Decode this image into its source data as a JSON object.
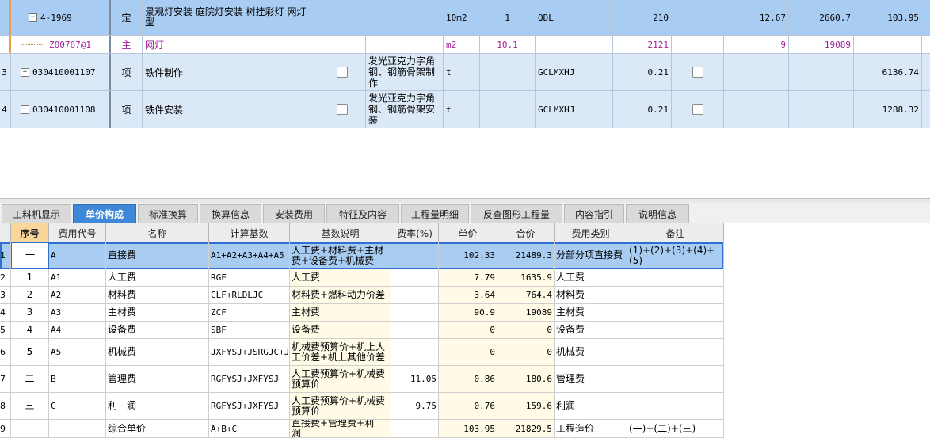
{
  "top_rows": [
    {
      "rownum": "",
      "code": "4-1969",
      "type": "定",
      "name": "景观灯安装 庭院灯安装 树挂彩灯 网灯型",
      "feature": "",
      "unit": "10m2",
      "qty": "1",
      "qty_expr": "QDL",
      "c1": "210",
      "c2": "",
      "c3": "12.67",
      "c4": "2660.7",
      "c5": "103.95"
    },
    {
      "rownum": "",
      "code": "Z00767@1",
      "type": "主",
      "name": "网灯",
      "feature": "",
      "unit": "m2",
      "qty": "10.1",
      "qty_expr": "",
      "c1": "2121",
      "c2": "",
      "c3": "9",
      "c4": "19089",
      "c5": ""
    },
    {
      "rownum": "3",
      "code": "030410001107",
      "type": "项",
      "name": "铁件制作",
      "feature": "发光亚克力字角钢、钢筋骨架制作",
      "unit": "t",
      "qty": "",
      "qty_expr": "GCLMXHJ",
      "c1": "0.21",
      "c2": "",
      "c3": "",
      "c4": "",
      "c5": "6136.74"
    },
    {
      "rownum": "4",
      "code": "030410001108",
      "type": "项",
      "name": "铁件安装",
      "feature": "发光亚克力字角钢、钢筋骨架安装",
      "unit": "t",
      "qty": "",
      "qty_expr": "GCLMXHJ",
      "c1": "0.21",
      "c2": "",
      "c3": "",
      "c4": "",
      "c5": "1288.32"
    }
  ],
  "tabs": [
    "工料机显示",
    "单价构成",
    "标准换算",
    "换算信息",
    "安装费用",
    "特征及内容",
    "工程量明细",
    "反查图形工程量",
    "内容指引",
    "说明信息"
  ],
  "active_tab": "单价构成",
  "headers": [
    "序号",
    "费用代号",
    "名称",
    "计算基数",
    "基数说明",
    "费率(%)",
    "单价",
    "合价",
    "费用类别",
    "备注"
  ],
  "rows": [
    {
      "n": "1",
      "seq": "一",
      "code": "A",
      "name": "直接费",
      "base": "A1+A2+A3+A4+A5",
      "desc": "人工费+材料费+主材费+设备费+机械费",
      "rate": "",
      "price": "102.33",
      "total": "21489.3",
      "cat": "分部分项直接费",
      "note": "(1)+(2)+(3)+(4)+(5)"
    },
    {
      "n": "2",
      "seq": "1",
      "code": "A1",
      "name": "人工费",
      "base": "RGF",
      "desc": "人工费",
      "rate": "",
      "price": "7.79",
      "total": "1635.9",
      "cat": "人工费",
      "note": ""
    },
    {
      "n": "3",
      "seq": "2",
      "code": "A2",
      "name": "材料费",
      "base": "CLF+RLDLJC",
      "desc": "材料费+燃料动力价差",
      "rate": "",
      "price": "3.64",
      "total": "764.4",
      "cat": "材料费",
      "note": ""
    },
    {
      "n": "4",
      "seq": "3",
      "code": "A3",
      "name": "主材费",
      "base": "ZCF",
      "desc": "主材费",
      "rate": "",
      "price": "90.9",
      "total": "19089",
      "cat": "主材费",
      "note": ""
    },
    {
      "n": "5",
      "seq": "4",
      "code": "A4",
      "name": "设备费",
      "base": "SBF",
      "desc": "设备费",
      "rate": "",
      "price": "0",
      "total": "0",
      "cat": "设备费",
      "note": ""
    },
    {
      "n": "6",
      "seq": "5",
      "code": "A5",
      "name": "机械费",
      "base": "JXFYSJ+JSRGJC+JSQTJC",
      "desc": "机械费预算价+机上人工价差+机上其他价差",
      "rate": "",
      "price": "0",
      "total": "0",
      "cat": "机械费",
      "note": ""
    },
    {
      "n": "7",
      "seq": "二",
      "code": "B",
      "name": "管理费",
      "base": "RGFYSJ+JXFYSJ",
      "desc": "人工费预算价+机械费预算价",
      "rate": "11.05",
      "price": "0.86",
      "total": "180.6",
      "cat": "管理费",
      "note": ""
    },
    {
      "n": "8",
      "seq": "三",
      "code": "C",
      "name": "利　润",
      "base": "RGFYSJ+JXFYSJ",
      "desc": "人工费预算价+机械费预算价",
      "rate": "9.75",
      "price": "0.76",
      "total": "159.6",
      "cat": "利润",
      "note": ""
    },
    {
      "n": "9",
      "seq": "",
      "code": "",
      "name": "综合单价",
      "base": "A+B+C",
      "desc": "直接费+管理费+利　润",
      "rate": "",
      "price": "103.95",
      "total": "21829.5",
      "cat": "工程造价",
      "note": "(一)+(二)+(三)"
    }
  ]
}
